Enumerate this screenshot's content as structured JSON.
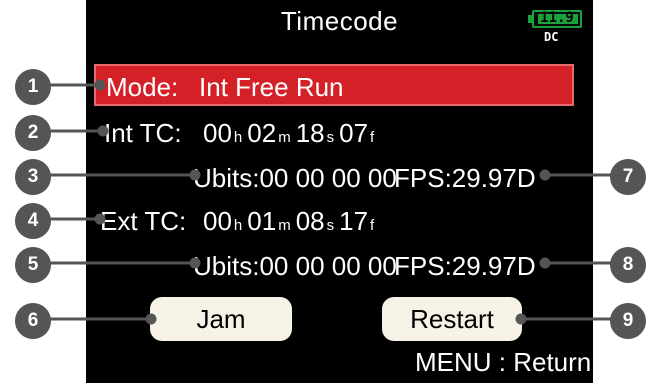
{
  "header": {
    "title": "Timecode",
    "battery_level": "11.9",
    "power_source": "DC"
  },
  "mode": {
    "label": "Mode:",
    "value": "Int Free Run"
  },
  "int_tc": {
    "label": "Int TC:",
    "h": "00",
    "h_unit": "h",
    "m": "02",
    "m_unit": "m",
    "s": "18",
    "s_unit": "s",
    "f": "07",
    "f_unit": "f",
    "ubits": "Ubits:00 00 00 00",
    "fps": "FPS:29.97D"
  },
  "ext_tc": {
    "label": "Ext TC:",
    "h": "00",
    "h_unit": "h",
    "m": "01",
    "m_unit": "m",
    "s": "08",
    "s_unit": "s",
    "f": "17",
    "f_unit": "f",
    "ubits": "Ubits:00 00 00 00",
    "fps": "FPS:29.97D"
  },
  "buttons": {
    "jam": "Jam",
    "restart": "Restart"
  },
  "footer": {
    "menu_return": "MENU : Return"
  },
  "callouts": [
    "1",
    "2",
    "3",
    "4",
    "5",
    "6",
    "7",
    "8",
    "9"
  ],
  "colors": {
    "mode_highlight": "#d42027",
    "battery": "#1aa33b",
    "callout": "#555555"
  }
}
